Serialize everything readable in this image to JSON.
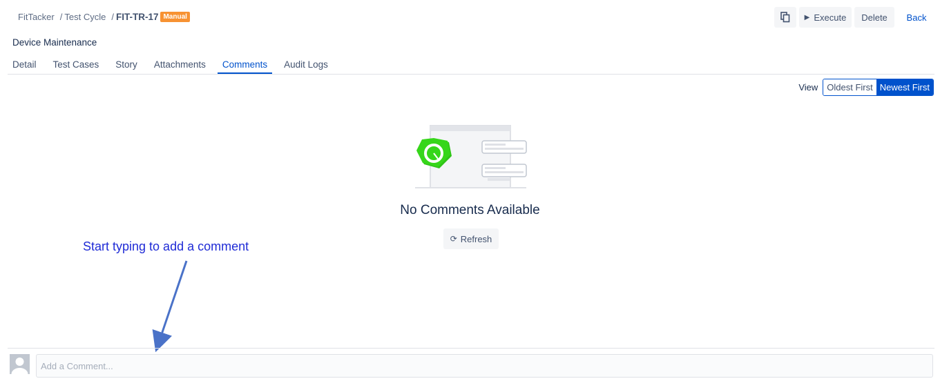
{
  "breadcrumb": {
    "project": "FitTacker",
    "section": "Test Cycle",
    "current": "FIT-TR-17",
    "badge": "Manual",
    "separator": "/"
  },
  "actions": {
    "copy_icon": "copy-icon",
    "execute_label": "Execute",
    "delete_label": "Delete",
    "back_label": "Back"
  },
  "page_title": "Device Maintenance",
  "tabs": [
    {
      "label": "Detail",
      "active": false
    },
    {
      "label": "Test Cases",
      "active": false
    },
    {
      "label": "Story",
      "active": false
    },
    {
      "label": "Attachments",
      "active": false
    },
    {
      "label": "Comments",
      "active": true
    },
    {
      "label": "Audit Logs",
      "active": false
    }
  ],
  "view": {
    "label": "View",
    "oldest": "Oldest First",
    "newest": "Newest First",
    "selected": "Newest First"
  },
  "empty_state": {
    "title": "No Comments Available",
    "refresh_label": "Refresh"
  },
  "annotation": {
    "text": "Start typing to add a comment"
  },
  "comment": {
    "placeholder": "Add a Comment...",
    "value": ""
  },
  "colors": {
    "accent": "#0052cc",
    "badge": "#f79232",
    "annotation": "#1f2bd6",
    "illustration_green": "#36d61a"
  }
}
